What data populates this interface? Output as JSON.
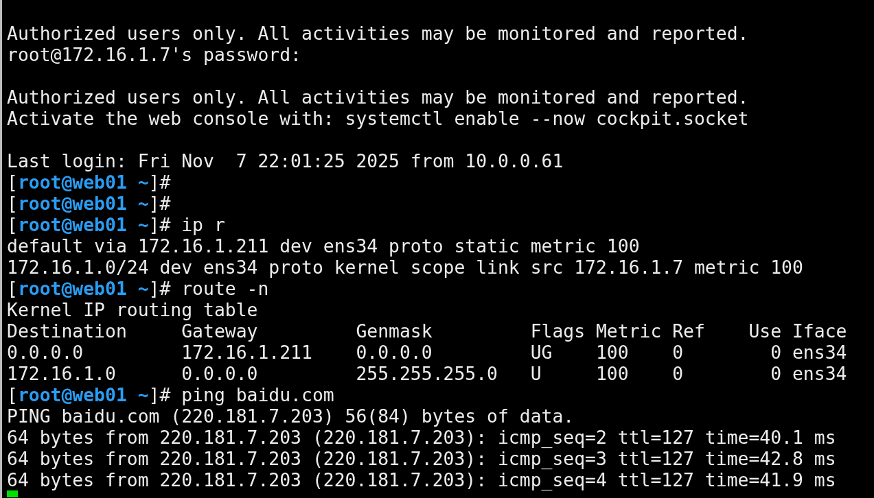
{
  "terminal": {
    "lines": [
      {
        "kind": "text",
        "text": "Authorized users only. All activities may be monitored and reported."
      },
      {
        "kind": "text",
        "text": "root@172.16.1.7's password:"
      },
      {
        "kind": "blank"
      },
      {
        "kind": "text",
        "text": "Authorized users only. All activities may be monitored and reported."
      },
      {
        "kind": "text",
        "text": "Activate the web console with: systemctl enable --now cockpit.socket"
      },
      {
        "kind": "blank"
      },
      {
        "kind": "text",
        "text": "Last login: Fri Nov  7 22:01:25 2025 from 10.0.0.61"
      },
      {
        "kind": "prompt",
        "open": "[",
        "user_host": "root@web01 ~",
        "close": "]#"
      },
      {
        "kind": "prompt",
        "open": "[",
        "user_host": "root@web01 ~",
        "close": "]#"
      },
      {
        "kind": "prompt",
        "open": "[",
        "user_host": "root@web01 ~",
        "close": "]#",
        "command": "ip r"
      },
      {
        "kind": "text",
        "text": "default via 172.16.1.211 dev ens34 proto static metric 100"
      },
      {
        "kind": "text",
        "text": "172.16.1.0/24 dev ens34 proto kernel scope link src 172.16.1.7 metric 100"
      },
      {
        "kind": "prompt",
        "open": "[",
        "user_host": "root@web01 ~",
        "close": "]#",
        "command": "route -n"
      },
      {
        "kind": "text",
        "text": "Kernel IP routing table"
      },
      {
        "kind": "text",
        "text": "Destination     Gateway         Genmask         Flags Metric Ref    Use Iface"
      },
      {
        "kind": "text",
        "text": "0.0.0.0         172.16.1.211    0.0.0.0         UG    100    0        0 ens34"
      },
      {
        "kind": "text",
        "text": "172.16.1.0      0.0.0.0         255.255.255.0   U     100    0        0 ens34"
      },
      {
        "kind": "prompt",
        "open": "[",
        "user_host": "root@web01 ~",
        "close": "]#",
        "command": "ping baidu.com"
      },
      {
        "kind": "text",
        "text": "PING baidu.com (220.181.7.203) 56(84) bytes of data."
      },
      {
        "kind": "text",
        "text": "64 bytes from 220.181.7.203 (220.181.7.203): icmp_seq=2 ttl=127 time=40.1 ms"
      },
      {
        "kind": "text",
        "text": "64 bytes from 220.181.7.203 (220.181.7.203): icmp_seq=3 ttl=127 time=42.8 ms"
      },
      {
        "kind": "text",
        "text": "64 bytes from 220.181.7.203 (220.181.7.203): icmp_seq=4 ttl=127 time=41.9 ms"
      },
      {
        "kind": "cursor"
      }
    ]
  }
}
